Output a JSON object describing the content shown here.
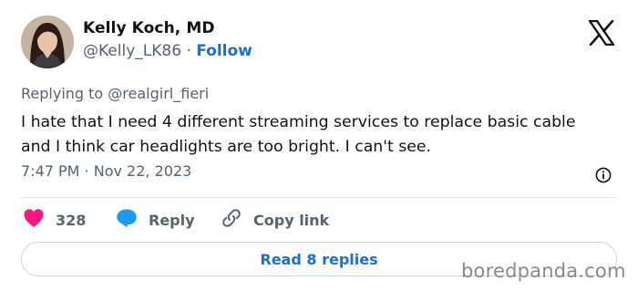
{
  "author": {
    "name": "Kelly Koch, MD",
    "handle": "@Kelly_LK86",
    "separator": "·",
    "follow_label": "Follow"
  },
  "reply_context": "Replying to @realgirl_fieri",
  "tweet": {
    "text_line1": "I hate that I need 4 different streaming services to replace basic cable",
    "text_line2": "and I think car headlights are too bright.  I can't see.",
    "timestamp": "7:47 PM · Nov 22, 2023"
  },
  "actions": {
    "like_count": "328",
    "reply_label": "Reply",
    "copy_link_label": "Copy link"
  },
  "read_replies_label": "Read 8 replies",
  "watermark": "boredpanda.com",
  "colors": {
    "link": "#1d6fcf",
    "heart": "#f91880",
    "reply_bubble": "#1d9bf0",
    "secondary_text": "#536471"
  },
  "icons": [
    "x-logo-icon",
    "info-icon",
    "heart-icon",
    "reply-bubble-icon",
    "link-icon"
  ]
}
